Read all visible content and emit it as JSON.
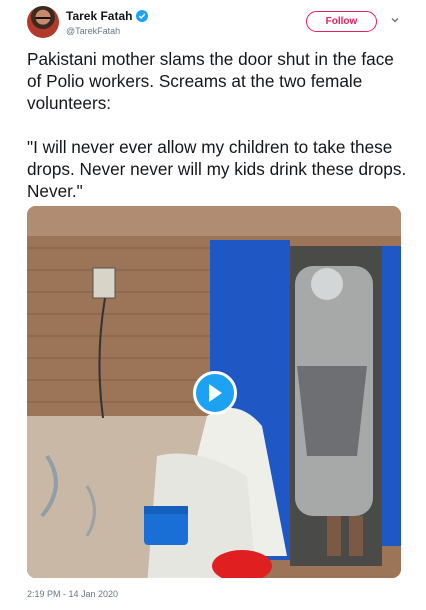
{
  "author": {
    "name": "Tarek Fatah",
    "handle": "@TarekFatah",
    "verified_icon": "verified-badge-icon"
  },
  "follow_label": "Follow",
  "tweet": {
    "line1": "Pakistani mother slams the door shut in the face of Polio workers. Screams at the two female volunteers:",
    "line2": "\"I will never ever allow my children to take these drops. Never never will my kids drink these drops. Never.\""
  },
  "media": {
    "type": "video",
    "play_icon": "play-icon"
  },
  "timestamp": "2:19 PM - 14 Jan 2020",
  "colors": {
    "follow_accent": "#e0245e",
    "twitter_blue": "#1da1f2",
    "text": "#14171a",
    "secondary_text": "#657786"
  }
}
